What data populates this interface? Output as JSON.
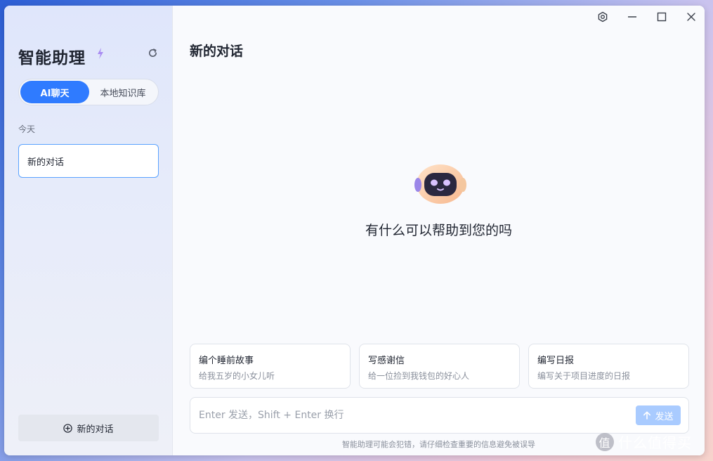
{
  "sidebar": {
    "title": "智能助理",
    "tabs": [
      {
        "label": "AI聊天",
        "active": true
      },
      {
        "label": "本地知识库",
        "active": false
      }
    ],
    "section_label": "今天",
    "conversations": [
      {
        "label": "新的对话",
        "selected": true
      }
    ],
    "new_conversation_label": "新的对话"
  },
  "window_controls": [
    "settings-icon",
    "minimize-icon",
    "maximize-icon",
    "close-icon"
  ],
  "main": {
    "title": "新的对话",
    "greeting": "有什么可以帮助到您的吗",
    "suggestions": [
      {
        "title": "编个睡前故事",
        "desc": "给我五岁的小女儿听"
      },
      {
        "title": "写感谢信",
        "desc": "给一位捡到我钱包的好心人"
      },
      {
        "title": "编写日报",
        "desc": "编写关于项目进度的日报"
      }
    ],
    "input_placeholder": "Enter 发送，Shift + Enter 换行",
    "send_label": "发送",
    "disclaimer": "智能助理可能会犯错，请仔细检查重要的信息避免被误导"
  },
  "watermark": "什么值得买",
  "colors": {
    "accent": "#2f7bff",
    "send_disabled": "#a9cbff",
    "selected_border": "#5aa2ff"
  }
}
